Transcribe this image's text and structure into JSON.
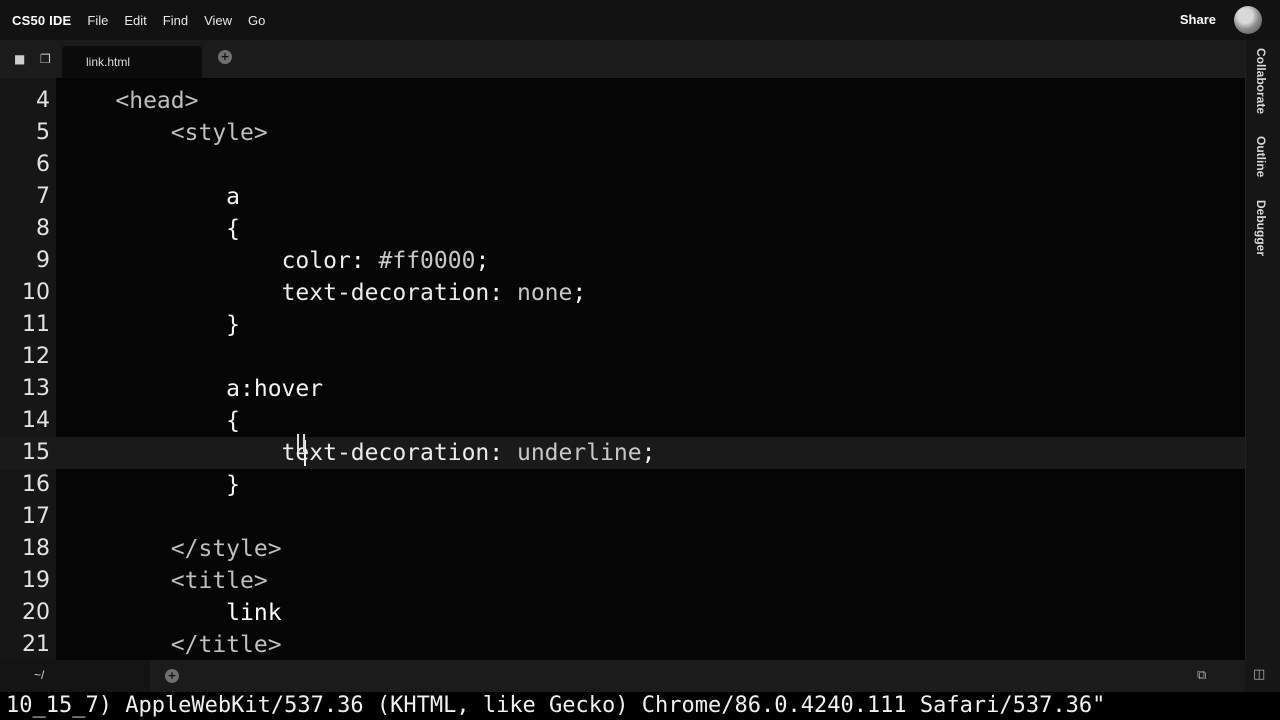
{
  "menubar": {
    "brand": "CS50 IDE",
    "items": [
      "File",
      "Edit",
      "Find",
      "View",
      "Go"
    ],
    "share_label": "Share"
  },
  "tabs": {
    "active_file": "link.html",
    "icons": [
      "folder-icon",
      "files-icon",
      "plus-icon"
    ]
  },
  "side_panel": {
    "collaborate": "Collaborate",
    "outline": "Outline",
    "debugger": "Debugger"
  },
  "editor": {
    "active_line": 15,
    "lines": [
      {
        "num": "4",
        "tokens": [
          {
            "t": "    ",
            "c": "c-pun"
          },
          {
            "t": "<head>",
            "c": "c-tag"
          }
        ]
      },
      {
        "num": "5",
        "tokens": [
          {
            "t": "        ",
            "c": "c-pun"
          },
          {
            "t": "<style>",
            "c": "c-tag"
          }
        ]
      },
      {
        "num": "6",
        "tokens": []
      },
      {
        "num": "7",
        "tokens": [
          {
            "t": "            ",
            "c": "c-pun"
          },
          {
            "t": "a",
            "c": "c-sel"
          }
        ]
      },
      {
        "num": "8",
        "tokens": [
          {
            "t": "            ",
            "c": "c-pun"
          },
          {
            "t": "{",
            "c": "c-pun"
          }
        ]
      },
      {
        "num": "9",
        "tokens": [
          {
            "t": "                ",
            "c": "c-pun"
          },
          {
            "t": "color",
            "c": "c-prop"
          },
          {
            "t": ": ",
            "c": "c-pun"
          },
          {
            "t": "#ff0000",
            "c": "c-val"
          },
          {
            "t": ";",
            "c": "c-pun"
          }
        ]
      },
      {
        "num": "10",
        "tokens": [
          {
            "t": "                ",
            "c": "c-pun"
          },
          {
            "t": "text-decoration",
            "c": "c-prop"
          },
          {
            "t": ": ",
            "c": "c-pun"
          },
          {
            "t": "none",
            "c": "c-val"
          },
          {
            "t": ";",
            "c": "c-pun"
          }
        ]
      },
      {
        "num": "11",
        "tokens": [
          {
            "t": "            ",
            "c": "c-pun"
          },
          {
            "t": "}",
            "c": "c-pun"
          }
        ]
      },
      {
        "num": "12",
        "tokens": []
      },
      {
        "num": "13",
        "tokens": [
          {
            "t": "            ",
            "c": "c-pun"
          },
          {
            "t": "a:hover",
            "c": "c-sel"
          }
        ]
      },
      {
        "num": "14",
        "tokens": [
          {
            "t": "            ",
            "c": "c-pun"
          },
          {
            "t": "{",
            "c": "c-pun"
          }
        ]
      },
      {
        "num": "15",
        "tokens": [
          {
            "t": "                ",
            "c": "c-pun"
          },
          {
            "t": "text-decoration",
            "c": "c-prop"
          },
          {
            "t": ": ",
            "c": "c-pun"
          },
          {
            "t": "underline",
            "c": "c-val"
          },
          {
            "t": ";",
            "c": "c-pun"
          }
        ]
      },
      {
        "num": "16",
        "tokens": [
          {
            "t": "            ",
            "c": "c-pun"
          },
          {
            "t": "}",
            "c": "c-pun"
          }
        ]
      },
      {
        "num": "17",
        "tokens": []
      },
      {
        "num": "18",
        "tokens": [
          {
            "t": "        ",
            "c": "c-pun"
          },
          {
            "t": "</style>",
            "c": "c-tag"
          }
        ]
      },
      {
        "num": "19",
        "tokens": [
          {
            "t": "        ",
            "c": "c-pun"
          },
          {
            "t": "<title>",
            "c": "c-tag"
          }
        ]
      },
      {
        "num": "20",
        "tokens": [
          {
            "t": "            ",
            "c": "c-pun"
          },
          {
            "t": "link",
            "c": "c-txt"
          }
        ]
      },
      {
        "num": "21",
        "tokens": [
          {
            "t": "        ",
            "c": "c-pun"
          },
          {
            "t": "</title>",
            "c": "c-tag"
          }
        ]
      }
    ]
  },
  "terminal": {
    "tab_label": "~/",
    "output": "10_15_7) AppleWebKit/537.36 (KHTML, like Gecko) Chrome/86.0.4240.111 Safari/537.36\""
  }
}
